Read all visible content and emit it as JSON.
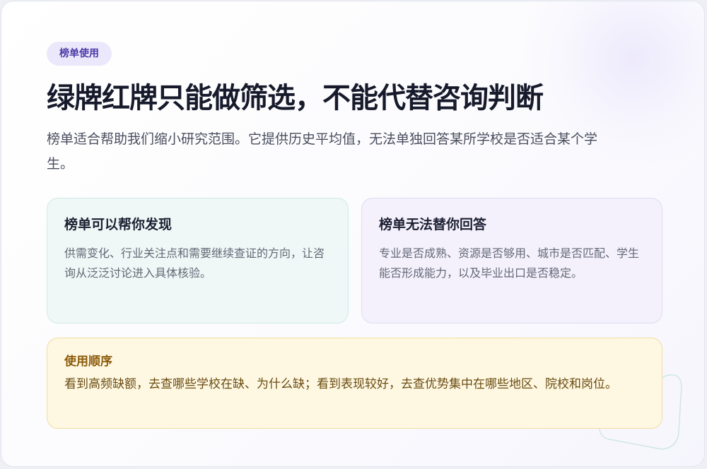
{
  "tag": "榜单使用",
  "title": "绿牌红牌只能做筛选，不能代替咨询判断",
  "subtitle": "榜单适合帮助我们缩小研究范围。它提供历史平均值，无法单独回答某所学校是否适合某个学生。",
  "panels": {
    "can": {
      "heading": "榜单可以帮你发现",
      "body": "供需变化、行业关注点和需要继续查证的方向，让咨询从泛泛讨论进入具体核验。"
    },
    "cannot": {
      "heading": "榜单无法替你回答",
      "body": "专业是否成熟、资源是否够用、城市是否匹配、学生能否形成能力，以及毕业出口是否稳定。"
    },
    "order": {
      "heading": "使用顺序",
      "body": "看到高频缺额，去查哪些学校在缺、为什么缺；看到表现较好，去查优势集中在哪些地区、院校和岗位。"
    }
  },
  "colors": {
    "accent": "#4b3aa8",
    "green_panel": "#eff8f6",
    "purple_panel": "#f4f1fc",
    "yellow_panel": "#fef8e3"
  }
}
